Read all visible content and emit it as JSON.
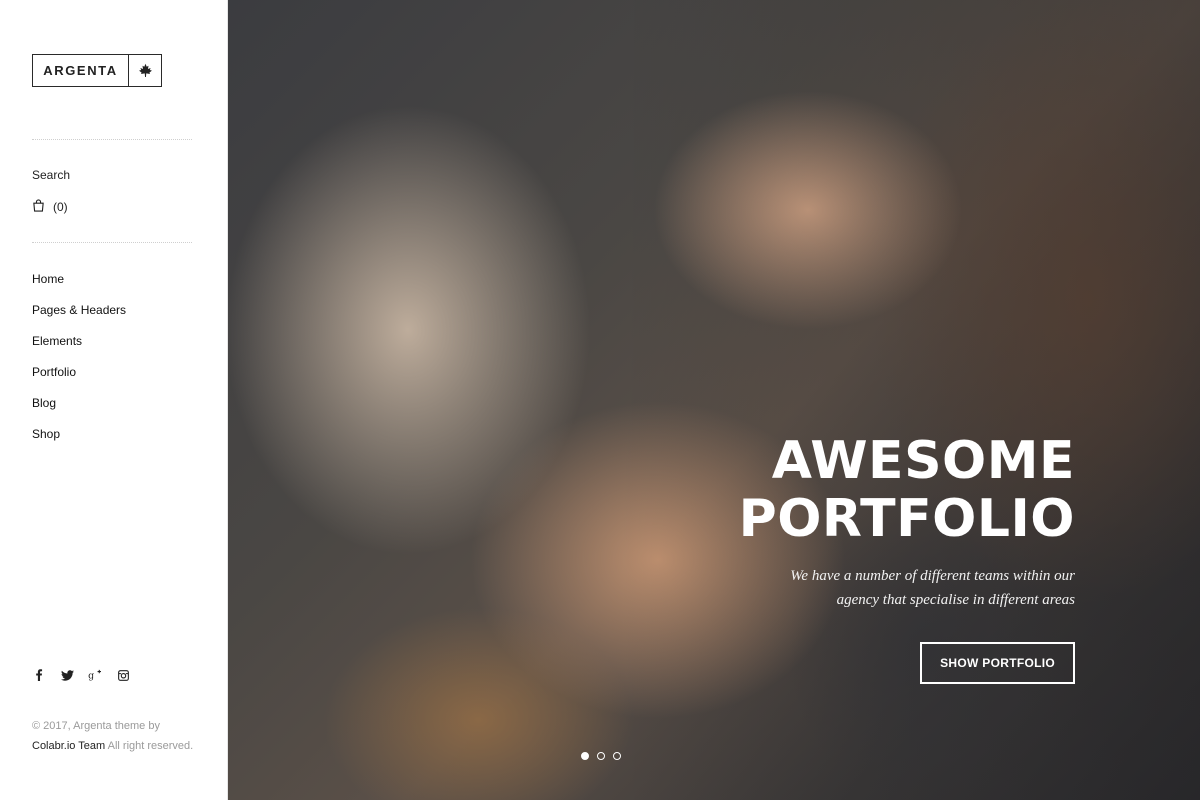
{
  "brand": {
    "name": "ARGENTA",
    "logo_icon": "maple-leaf-icon"
  },
  "utility": {
    "search_label": "Search",
    "cart_count": "(0)",
    "cart_icon": "shopping-bag-icon"
  },
  "nav": [
    {
      "label": "Home"
    },
    {
      "label": "Pages & Headers"
    },
    {
      "label": "Elements"
    },
    {
      "label": "Portfolio"
    },
    {
      "label": "Blog"
    },
    {
      "label": "Shop"
    }
  ],
  "social": [
    "facebook-icon",
    "twitter-icon",
    "google-plus-icon",
    "instagram-icon"
  ],
  "footer": {
    "prefix": "© 2017, Argenta theme by",
    "link": "Colabr.io Team",
    "suffix": "All right reserved."
  },
  "hero": {
    "title": "AWESOME\nPORTFOLIO",
    "subtitle": "We have a number of different teams within our agency that specialise in different areas",
    "button_label": "SHOW PORTFOLIO",
    "slides": 3,
    "active_slide": 1
  },
  "colors": {
    "accent": "#ffffff",
    "text": "#222222",
    "muted": "#9a9a9a"
  }
}
